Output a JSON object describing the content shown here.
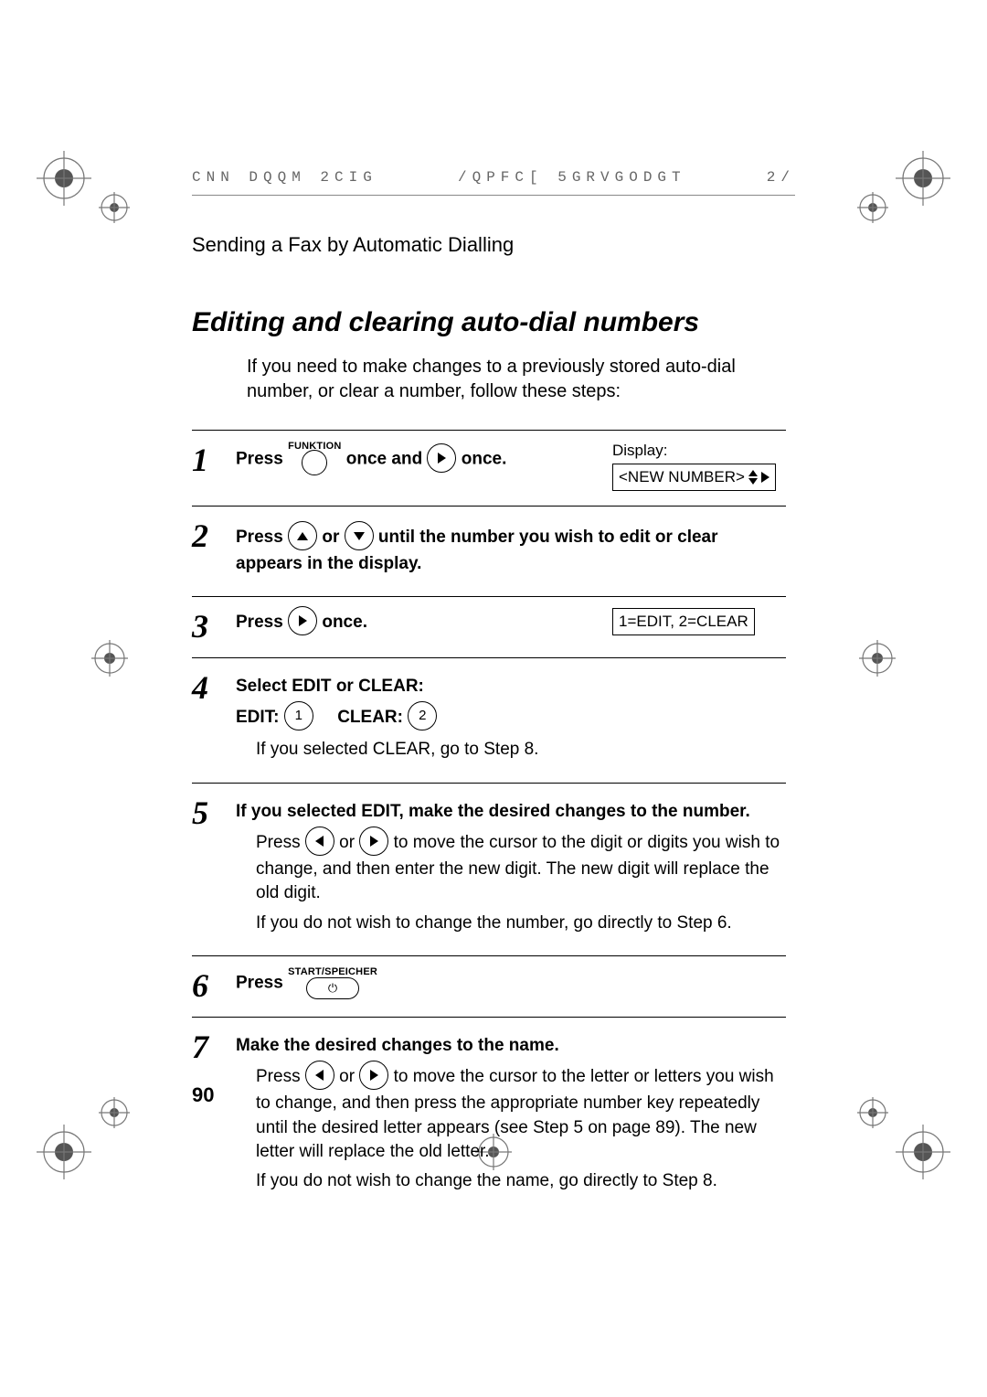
{
  "header": {
    "left": "CNN DQQM 2CIG",
    "mid": "/QPFC[ 5GRVGODGT",
    "right": "2/"
  },
  "section_label": "Sending a Fax by Automatic Dialling",
  "title": "Editing and clearing auto-dial numbers",
  "intro": "If you need to make changes to a previously stored auto-dial number, or clear a number, follow these steps:",
  "steps": {
    "s1": {
      "num": "1",
      "press": "Press",
      "funktion": "FUNKTION",
      "once_and": "once and",
      "once": "once.",
      "display_label": "Display:",
      "display_value": "<NEW NUMBER>"
    },
    "s2": {
      "num": "2",
      "press": "Press",
      "or": "or",
      "rest": "until the number you wish to edit or clear appears in the display."
    },
    "s3": {
      "num": "3",
      "press": "Press",
      "once": "once.",
      "display_value": "1=EDIT, 2=CLEAR"
    },
    "s4": {
      "num": "4",
      "head": "Select EDIT or CLEAR:",
      "edit_label": "EDIT:",
      "edit_key": "1",
      "clear_label": "CLEAR:",
      "clear_key": "2",
      "note": "If you selected CLEAR, go to Step 8."
    },
    "s5": {
      "num": "5",
      "head": "If you selected EDIT, make the desired changes to the number.",
      "p1a": "Press",
      "p1_or": "or",
      "p1b": "to move the cursor to the digit or digits you wish to change, and then enter the new digit. The new digit will replace the old digit.",
      "p2": "If you do not wish to change the number, go directly to Step 6."
    },
    "s6": {
      "num": "6",
      "press": "Press",
      "label": "START/SPEICHER"
    },
    "s7": {
      "num": "7",
      "head": "Make the desired changes to the name.",
      "p1a": "Press",
      "p1_or": "or",
      "p1b": "to move the cursor to the letter or letters you wish to change, and then press the appropriate number key repeatedly until the desired letter appears (see Step 5 on page 89). The new letter will replace the old letter.",
      "p2": "If you do not wish to change the name, go directly to Step 8."
    }
  },
  "page_number": "90"
}
